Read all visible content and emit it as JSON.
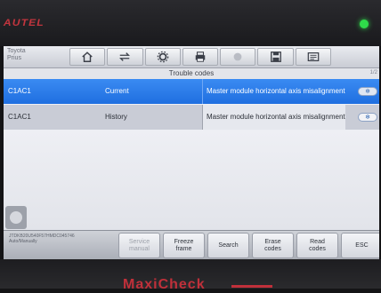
{
  "device": {
    "brand_top": "AUTEL",
    "brand_bottom": "MaxiCheck"
  },
  "vehicle": {
    "make": "Toyota",
    "model": "Prius"
  },
  "toolbar": {
    "icons": [
      "home-icon",
      "vehicle-swap-icon",
      "settings-gear-icon",
      "print-icon",
      "help-icon",
      "save-icon",
      "data-log-icon"
    ]
  },
  "screen": {
    "title": "Trouble codes",
    "indicator": "1/2"
  },
  "codes": [
    {
      "code": "C1AC1",
      "status": "Current",
      "description": "Master module horizontal axis misalignment",
      "selected": true
    },
    {
      "code": "C1AC1",
      "status": "History",
      "description": "Master module horizontal axis misalignment",
      "selected": false
    }
  ],
  "footer": {
    "vin": "JTDKB20U540F57HMDC045746",
    "subtitle": "Auto/Manually",
    "buttons": [
      {
        "label": "Service\nmanual",
        "enabled": false
      },
      {
        "label": "Freeze\nframe",
        "enabled": true
      },
      {
        "label": "Search",
        "enabled": true
      },
      {
        "label": "Erase\ncodes",
        "enabled": true
      },
      {
        "label": "Read\ncodes",
        "enabled": true
      },
      {
        "label": "ESC",
        "enabled": true
      }
    ]
  },
  "colors": {
    "selected_row": "#2a7de9",
    "brand_red": "#c0303a",
    "power_led": "#2fdc4a"
  }
}
